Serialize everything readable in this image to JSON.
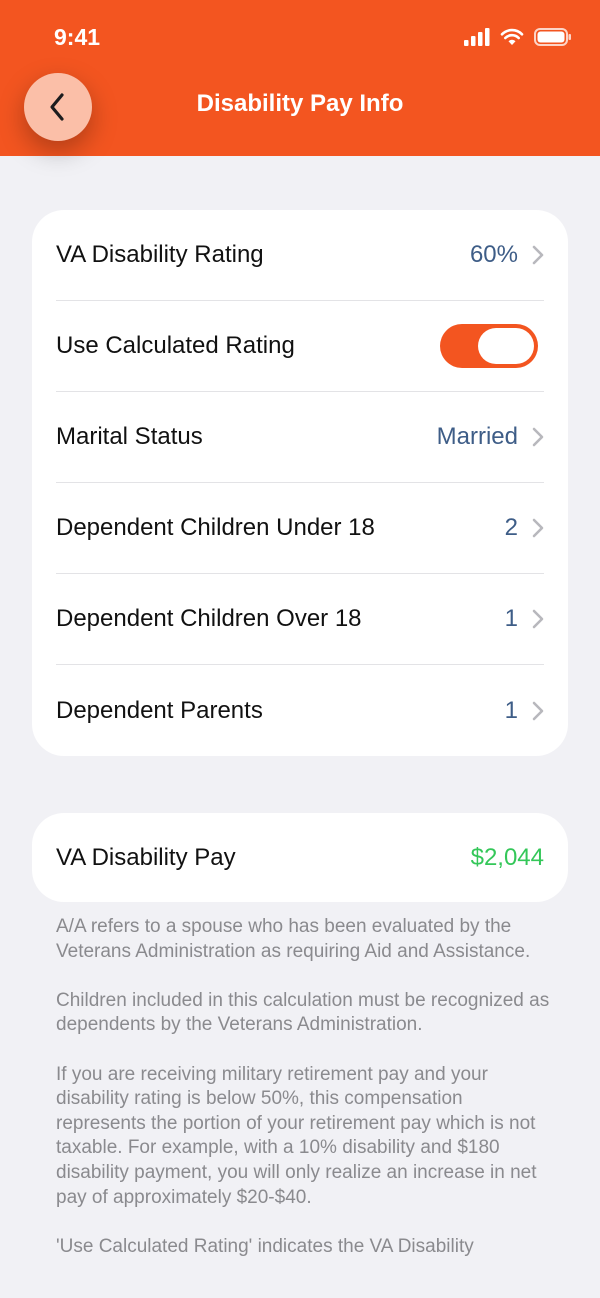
{
  "status_bar": {
    "time": "9:41",
    "icons": [
      "signal-icon",
      "wifi-icon",
      "battery-icon"
    ]
  },
  "header": {
    "title": "Disability Pay Info",
    "back_icon": "chevron-left-icon",
    "color": "#f35520"
  },
  "settings": {
    "rating": {
      "label": "VA Disability Rating",
      "value": "60%"
    },
    "calculated": {
      "label": "Use Calculated Rating",
      "on": true
    },
    "marital": {
      "label": "Marital Status",
      "value": "Married"
    },
    "children_under": {
      "label": "Dependent Children Under 18",
      "value": "2"
    },
    "children_over": {
      "label": "Dependent Children Over 18",
      "value": "1"
    },
    "parents": {
      "label": "Dependent Parents",
      "value": "1"
    }
  },
  "pay": {
    "label": "VA Disability Pay",
    "value": "$2,044",
    "value_color": "#34c759"
  },
  "notes": [
    "A/A refers to a spouse who has been evaluated by the Veterans Administration as requiring Aid and Assistance.",
    "Children included in this calculation must be recognized as dependents by the Veterans Administration.",
    "If you are receiving military retirement pay and your disability rating is below 50%, this compensation represents the portion of your retirement pay which is not taxable. For example, with a 10% disability and $180 disability payment, you will only realize an increase in net pay of approximately $20-$40.",
    "'Use Calculated Rating' indicates the VA Disability"
  ]
}
